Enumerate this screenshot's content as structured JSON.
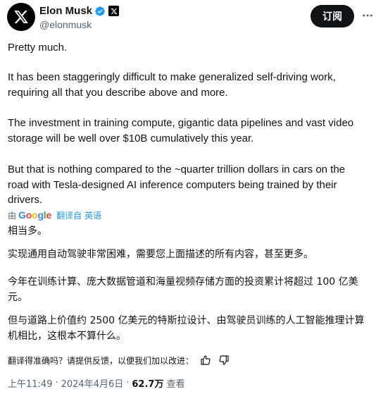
{
  "author": {
    "display_name": "Elon Musk",
    "handle": "@elonmusk"
  },
  "actions": {
    "subscribe_label": "订阅"
  },
  "icons": {
    "avatar": "x-logo-icon",
    "verified": "verified-check-icon",
    "affiliate": "x-badge-icon",
    "more": "more-dots-icon",
    "like": "thumbs-up-icon",
    "dislike": "thumbs-down-icon"
  },
  "colors": {
    "verified": "#1d9bf0",
    "text": "#0f1419",
    "muted": "#536471",
    "link": "#1d9bf0"
  },
  "post": {
    "paragraphs": [
      "Pretty much.",
      "It has been staggeringly difficult to make generalized self-driving work, requiring all that you describe above and more.",
      "The investment in training compute, gigantic data pipelines and vast video storage will be well over $10B cumulatively this year.",
      "But that is nothing compared to the ~quarter trillion dollars in cars on the road with Tesla-designed AI inference computers being trained by their drivers."
    ]
  },
  "translation": {
    "by_label": "由",
    "google": "Google",
    "translated_from": "翻译自",
    "source_language": "英语",
    "paragraphs": [
      "相当多。",
      "实现通用自动驾驶非常困难，需要您上面描述的所有内容，甚至更多。",
      "今年在训练计算、庞大数据管道和海量视频存储方面的投资累计将超过 100 亿美元。",
      "但与道路上价值约 2500 亿美元的特斯拉设计、由驾驶员训练的人工智能推理计算机相比，这根本不算什么。"
    ],
    "feedback_prompt": "翻译得准确吗？请提供反馈，以便我们加以改进："
  },
  "meta": {
    "time": "上午11:49",
    "date": "2024年4月6日",
    "separator": "·",
    "views_count": "62.7万",
    "views_label": "查看"
  }
}
